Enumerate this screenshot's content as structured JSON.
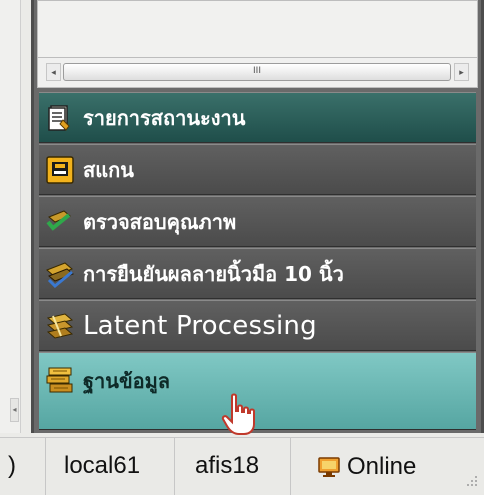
{
  "nav_pane": {
    "scrollbar": {
      "thumb_glyph": "III",
      "left_arrow": "◂",
      "right_arrow": "▸"
    },
    "items": [
      {
        "label": "รายการสถานะงาน",
        "icon": "document-list-icon"
      },
      {
        "label": "สแกน",
        "icon": "scanner-icon"
      },
      {
        "label": "ตรวจสอบคุณภาพ",
        "icon": "quality-check-icon"
      },
      {
        "label": "การยืนยันผลลายนิ้วมือ 10 นิ้ว",
        "icon": "verify-fingerprint-icon"
      },
      {
        "label": "Latent Processing",
        "icon": "latent-processing-icon"
      },
      {
        "label": "ฐานข้อมูล",
        "icon": "database-icon"
      }
    ]
  },
  "statusbar": {
    "partial_text": ")",
    "host": "local61",
    "user": "afis18",
    "connection": "Online"
  },
  "colors": {
    "teal_dark": "#1f4e4a",
    "teal_light": "#6fb8b4",
    "nav_dark": "#555555"
  }
}
